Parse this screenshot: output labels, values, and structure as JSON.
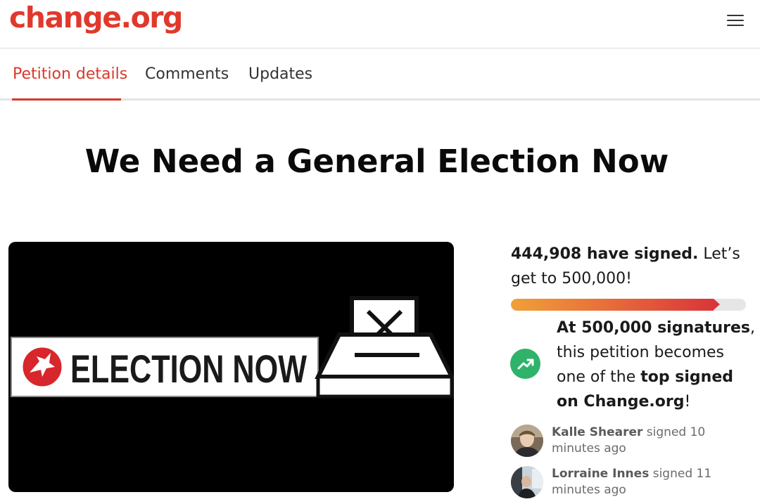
{
  "header": {
    "logo_text": "change.org",
    "menu_icon": "hamburger-menu-icon"
  },
  "tabs": [
    {
      "label": "Petition details",
      "active": true
    },
    {
      "label": "Comments",
      "active": false
    },
    {
      "label": "Updates",
      "active": false
    }
  ],
  "petition": {
    "title": "We Need a General Election Now",
    "banner_text": "ELECTION NOW",
    "banner_icon": "eagle-logo-icon",
    "ballot_icon": "ballot-box-x-icon"
  },
  "signatures": {
    "count_text": "444,908 have signed.",
    "goal_text": " Let’s get to 500,000!",
    "signed": 444908,
    "goal": 500000
  },
  "milestone": {
    "bold_1": "At 500,000 signatures",
    "text_1": ", this petition becomes one of the ",
    "bold_2": "top signed on Change.org",
    "text_2": "!",
    "icon": "trending-up-icon"
  },
  "recent_signers": [
    {
      "name": "Kalle Shearer",
      "action": " signed 10 minutes ago"
    },
    {
      "name": "Lorraine Innes",
      "action": " signed 11 minutes ago"
    }
  ],
  "colors": {
    "brand": "#e0392c",
    "accent_green": "#2fb36a"
  }
}
